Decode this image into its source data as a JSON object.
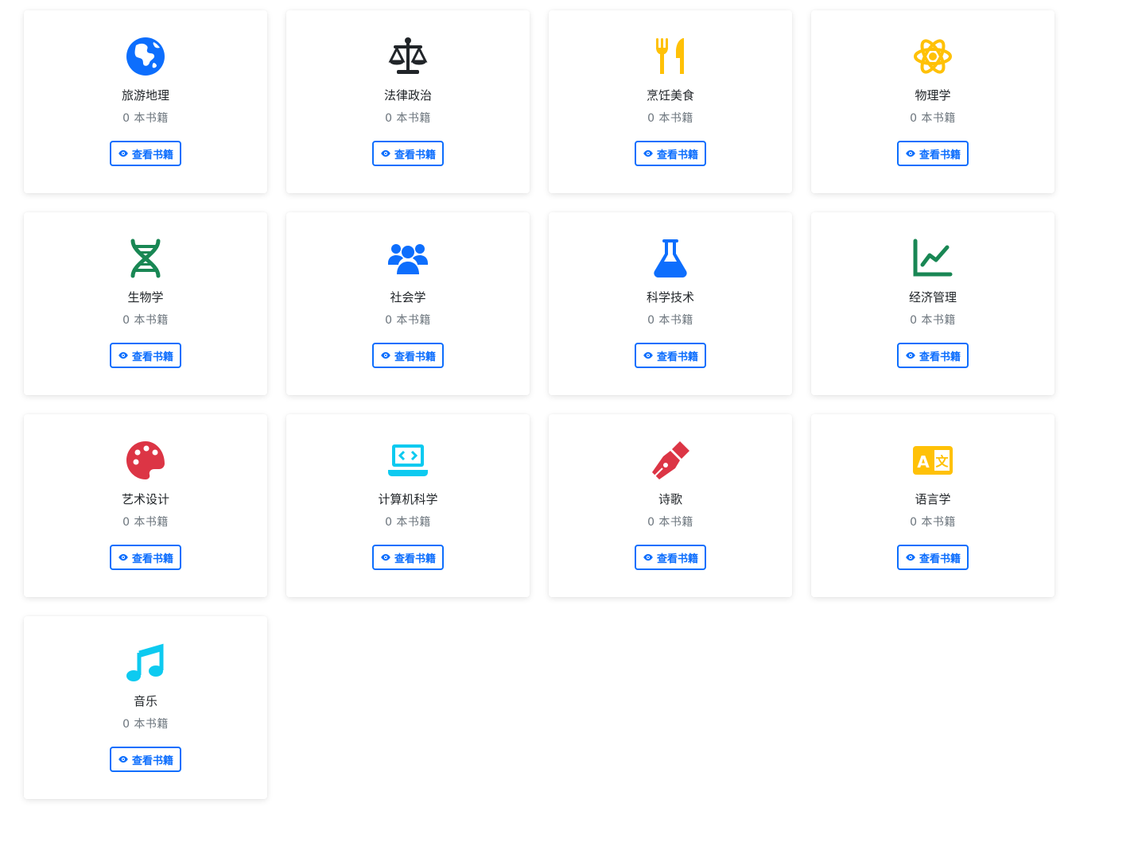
{
  "button_label": "查看书籍",
  "categories": [
    {
      "name": "旅游地理",
      "count": "0 本书籍",
      "icon": "globe-icon",
      "color": "#0d6efd"
    },
    {
      "name": "法律政治",
      "count": "0 本书籍",
      "icon": "scale-icon",
      "color": "#212529"
    },
    {
      "name": "烹饪美食",
      "count": "0 本书籍",
      "icon": "utensils-icon",
      "color": "#ffc107"
    },
    {
      "name": "物理学",
      "count": "0 本书籍",
      "icon": "atom-icon",
      "color": "#ffc107"
    },
    {
      "name": "生物学",
      "count": "0 本书籍",
      "icon": "dna-icon",
      "color": "#198754"
    },
    {
      "name": "社会学",
      "count": "0 本书籍",
      "icon": "users-icon",
      "color": "#0d6efd"
    },
    {
      "name": "科学技术",
      "count": "0 本书籍",
      "icon": "flask-icon",
      "color": "#0d6efd"
    },
    {
      "name": "经济管理",
      "count": "0 本书籍",
      "icon": "chart-line-icon",
      "color": "#198754"
    },
    {
      "name": "艺术设计",
      "count": "0 本书籍",
      "icon": "palette-icon",
      "color": "#dc3545"
    },
    {
      "name": "计算机科学",
      "count": "0 本书籍",
      "icon": "laptop-code-icon",
      "color": "#0dcaf0"
    },
    {
      "name": "诗歌",
      "count": "0 本书籍",
      "icon": "pen-nib-icon",
      "color": "#dc3545"
    },
    {
      "name": "语言学",
      "count": "0 本书籍",
      "icon": "language-icon",
      "color": "#ffc107"
    },
    {
      "name": "音乐",
      "count": "0 本书籍",
      "icon": "music-icon",
      "color": "#0dcaf0"
    }
  ],
  "colors": {
    "button": "#0d6efd",
    "count_text": "#6c757d",
    "name_text": "#212529"
  }
}
